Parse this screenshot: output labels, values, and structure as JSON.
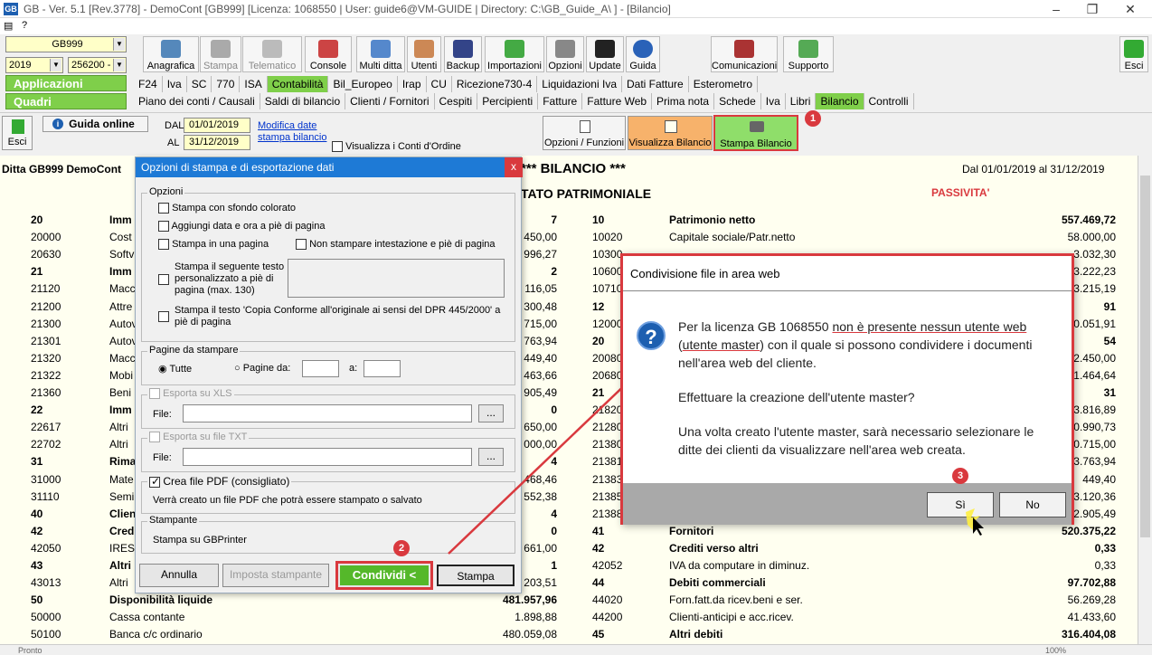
{
  "window": {
    "title": "GB - Ver. 5.1 [Rev.3778] -  DemoCont [GB999]   [Licenza: 1068550 | User: guide6@VM-GUIDE | Directory: C:\\GB_Guide_A\\ ] - [Bilancio]",
    "logo": "GB",
    "menu_q": "?"
  },
  "toolbar": {
    "company": "GB999",
    "year": "2019",
    "code": "256200 -",
    "buttons": [
      "Anagrafica",
      "Stampa",
      "Telematico",
      "Console",
      "Multi ditta",
      "Utenti",
      "Backup",
      "Importazioni",
      "Opzioni",
      "Update",
      "Guida",
      "Comunicazioni",
      "Supporto",
      "Esci"
    ]
  },
  "applicazioni": {
    "label": "Applicazioni",
    "tabs": [
      "F24",
      "Iva",
      "SC",
      "770",
      "ISA",
      "Contabilità",
      "Bil_Europeo",
      "Irap",
      "CU",
      "Ricezione730-4",
      "Liquidazioni Iva",
      "Dati Fatture",
      "Esterometro"
    ]
  },
  "quadri": {
    "label": "Quadri",
    "tabs": [
      "Piano dei conti / Causali",
      "Saldi di bilancio",
      "Clienti / Fornitori",
      "Cespiti",
      "Percipienti",
      "Fatture",
      "Fatture Web",
      "Prima nota",
      "Schede",
      "Iva",
      "Libri",
      "Bilancio",
      "Controlli"
    ]
  },
  "subtool": {
    "esci": "Esci",
    "guida": "Guida online",
    "dal_label": "DAL",
    "dal": "01/01/2019",
    "al_label": "AL",
    "al": "31/12/2019",
    "link1": "Modifica date",
    "link2": "stampa bilancio",
    "conti_ordine": "Visualizza i Conti d'Ordine",
    "opzioni": "Opzioni / Funzioni",
    "visualizza": "Visualizza Bilancio",
    "stampa": "Stampa Bilancio",
    "badge1": "1"
  },
  "report": {
    "ditta": "Ditta GB999  DemoCont",
    "title": "*** BILANCIO ***",
    "period": "Dal 01/01/2019 al 31/12/2019",
    "section": "TATO PATRIMONIALE",
    "passivita": "PASSIVITA'",
    "left": [
      [
        "20",
        "Imm",
        "7",
        true
      ],
      [
        "20000",
        "Cost",
        "450,00",
        false
      ],
      [
        "20630",
        "Softv",
        "996,27",
        false
      ],
      [
        "21",
        "Imm",
        "2",
        true
      ],
      [
        "21120",
        "Macc",
        "116,05",
        false
      ],
      [
        "21200",
        "Attre",
        "300,48",
        false
      ],
      [
        "21300",
        "Autov",
        "715,00",
        false
      ],
      [
        "21301",
        "Autov",
        "763,94",
        false
      ],
      [
        "21320",
        "Macc",
        "449,40",
        false
      ],
      [
        "21322",
        "Mobi",
        "463,66",
        false
      ],
      [
        "21360",
        "Beni",
        "905,49",
        false
      ],
      [
        "22",
        "Imm",
        "0",
        true
      ],
      [
        "22617",
        "Altri",
        "650,00",
        false
      ],
      [
        "22702",
        "Altri",
        "000,00",
        false
      ],
      [
        "31",
        "Rima",
        "4",
        true
      ],
      [
        "31000",
        "Mate",
        "468,46",
        false
      ],
      [
        "31110",
        "Semi",
        "552,38",
        false
      ],
      [
        "40",
        "Clien",
        "4",
        true
      ],
      [
        "42",
        "Cred",
        "0",
        true
      ],
      [
        "42050",
        "IRES",
        "661,00",
        false
      ],
      [
        "43",
        "Altri",
        "1",
        true
      ],
      [
        "43013",
        "Altri",
        "203,51",
        false
      ],
      [
        "50",
        "Disponibilità liquide",
        "481.957,96",
        true
      ],
      [
        "50000",
        "Cassa contante",
        "1.898,88",
        false
      ],
      [
        "50100",
        "Banca c/c ordinario",
        "480.059,08",
        false
      ]
    ],
    "right": [
      [
        "10",
        "Patrimonio netto",
        "557.469,72",
        true
      ],
      [
        "10020",
        "Capitale sociale/Patr.netto",
        "58.000,00",
        false
      ],
      [
        "10300",
        "",
        "3.032,30",
        false
      ],
      [
        "10600",
        "",
        "3.222,23",
        false
      ],
      [
        "10710",
        "",
        "3.215,19",
        false
      ],
      [
        "12",
        "",
        "91",
        true
      ],
      [
        "12000",
        "",
        "0.051,91",
        false
      ],
      [
        "20",
        "",
        "54",
        true
      ],
      [
        "20080",
        "",
        "2.450,00",
        false
      ],
      [
        "20680",
        "",
        "1.464,64",
        false
      ],
      [
        "21",
        "",
        "31",
        true
      ],
      [
        "21820",
        "",
        "3.816,89",
        false
      ],
      [
        "21280",
        "",
        "0.990,73",
        false
      ],
      [
        "21380",
        "",
        "0.715,00",
        false
      ],
      [
        "21381",
        "",
        "3.763,94",
        false
      ],
      [
        "21383",
        "",
        "449,40",
        false
      ],
      [
        "21385",
        "",
        "3.120,36",
        false
      ],
      [
        "21388",
        "",
        "2.905,49",
        false
      ],
      [
        "41",
        "Fornitori",
        "520.375,22",
        true
      ],
      [
        "42",
        "Crediti verso altri",
        "0,33",
        true
      ],
      [
        "42052",
        "IVA da computare in diminuz.",
        "0,33",
        false
      ],
      [
        "44",
        "Debiti commerciali",
        "97.702,88",
        true
      ],
      [
        "44020",
        "Forn.fatt.da ricev.beni e ser.",
        "56.269,28",
        false
      ],
      [
        "44200",
        "Clienti-anticipi e acc.ricev.",
        "41.433,60",
        false
      ],
      [
        "45",
        "Altri debiti",
        "316.404,08",
        true
      ]
    ]
  },
  "opts": {
    "title": "Opzioni di stampa e di esportazione dati",
    "close": "x",
    "opzioni": "Opzioni",
    "sfondo": "Stampa con sfondo colorato",
    "data_ora": "Aggiungi data e ora a piè di pagina",
    "una_pagina": "Stampa in una pagina",
    "no_intest": "Non stampare intestazione e piè di pagina",
    "testo_pers": "Stampa il seguente testo personalizzato a piè di pagina (max. 130)",
    "copia": "Stampa il testo 'Copia Conforme all'originale ai sensi del DPR 445/2000' a piè di pagina",
    "pagine": "Pagine da stampare",
    "tutte": "Tutte",
    "pagine_da": "Pagine da:",
    "a": "a:",
    "xls": "Esporta su XLS",
    "file": "File:",
    "txt": "Esporta su file TXT",
    "pdf": "Crea file PDF (consigliato)",
    "pdf_desc": "Verrà creato un file PDF che potrà essere stampato o salvato",
    "stampante": "Stampante",
    "stampante_val": "Stampa su GBPrinter",
    "annulla": "Annulla",
    "imposta": "Imposta stampante",
    "condividi": "Condividi",
    "stampa": "Stampa",
    "badge2": "2",
    "dots": "..."
  },
  "msg": {
    "title": "Condivisione file in area web",
    "p1a": "Per la licenza GB 1068550 ",
    "p1b": "non è presente nessun utente web",
    "p1c": "(",
    "p1d": "utente master",
    "p1e": ") con il quale si possono condividere i documenti",
    "p1f": "nell'area web del cliente.",
    "p2": "Effettuare la creazione dell'utente master?",
    "p3a": "Una volta creato l'utente master, sarà necessario selezionare le",
    "p3b": "ditte dei clienti da visualizzare nell'area web creata.",
    "si": "Sì",
    "no": "No",
    "badge3": "3",
    "icon": "?"
  },
  "status": {
    "left": "Pronto",
    "zoom": "100%"
  },
  "colors": {
    "accent": "#7fcf4a",
    "highlight": "#d9393e",
    "dialog": "#1e7ad6"
  }
}
